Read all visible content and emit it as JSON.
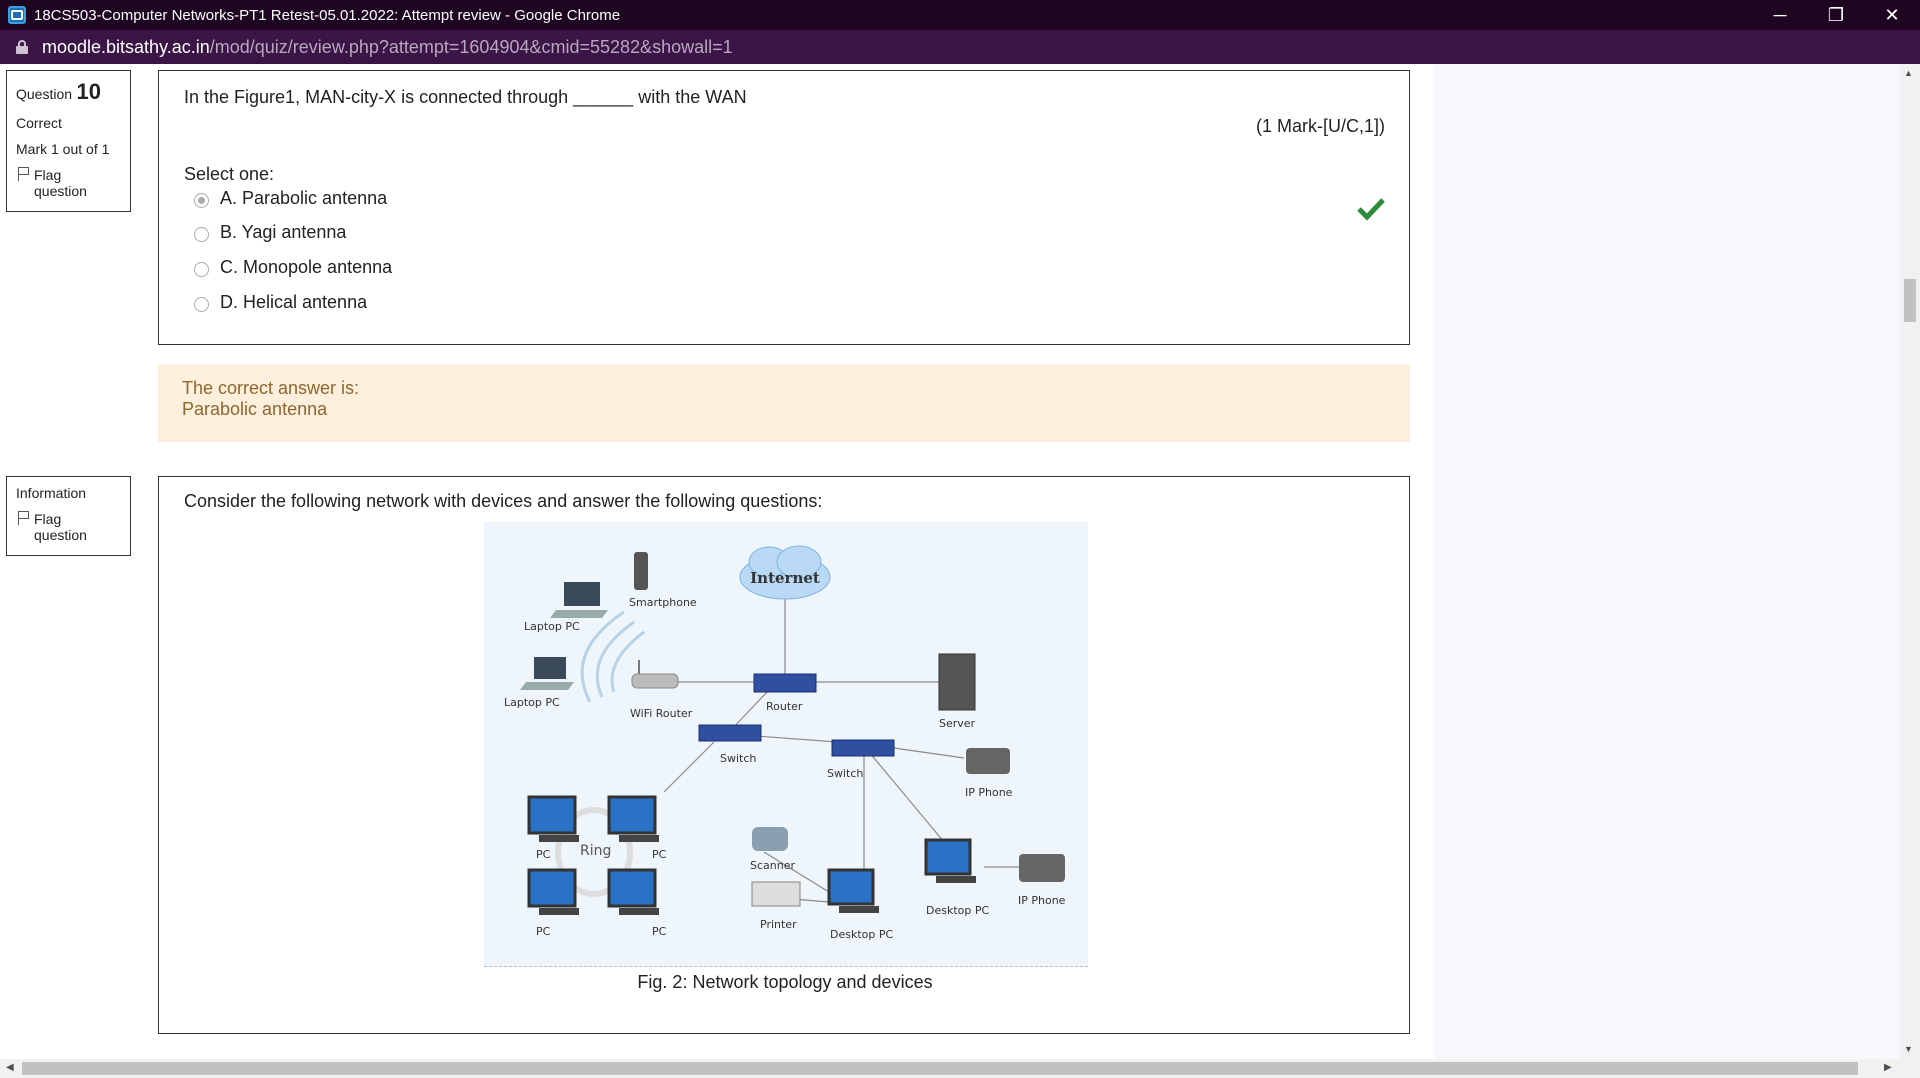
{
  "window": {
    "title": "18CS503-Computer Networks-PT1 Retest-05.01.2022: Attempt review - Google Chrome",
    "controls": {
      "minimize": "─",
      "restore": "❐",
      "close": "✕"
    }
  },
  "address": {
    "domain": "moodle.bitsathy.ac.in",
    "path": "/mod/quiz/review.php?attempt=1604904&cmid=55282&showall=1"
  },
  "question10": {
    "label": "Question",
    "number": "10",
    "state": "Correct",
    "mark": "Mark 1 out of 1",
    "flag": "Flag question",
    "text": "In the Figure1, MAN-city-X is connected through ______ with the WAN",
    "marks": "(1 Mark-[U/C,1])",
    "select_one": "Select one:",
    "options": [
      {
        "label": "A. Parabolic antenna",
        "selected": true
      },
      {
        "label": "B. Yagi antenna",
        "selected": false
      },
      {
        "label": "C. Monopole antenna",
        "selected": false
      },
      {
        "label": "D. Helical antenna",
        "selected": false
      }
    ],
    "feedback_heading": "The correct answer is:",
    "feedback_answer": "Parabolic antenna"
  },
  "information": {
    "label": "Information",
    "flag": "Flag question",
    "text": "Consider the following network with devices and answer the following questions:",
    "caption": "Fig. 2: Network topology and devices",
    "figure_labels": {
      "internet": "Internet",
      "smartphone": "Smartphone",
      "laptop1": "Laptop PC",
      "laptop2": "Laptop PC",
      "wifi_router": "WiFi Router",
      "router": "Router",
      "server": "Server",
      "switch1": "Switch",
      "switch2": "Switch",
      "ip_phone1": "IP Phone",
      "ip_phone2": "IP Phone",
      "ring": "Ring",
      "pc1": "PC",
      "pc2": "PC",
      "pc3": "PC",
      "pc4": "PC",
      "scanner": "Scanner",
      "printer": "Printer",
      "desktop1": "Desktop PC",
      "desktop2": "Desktop PC"
    }
  }
}
